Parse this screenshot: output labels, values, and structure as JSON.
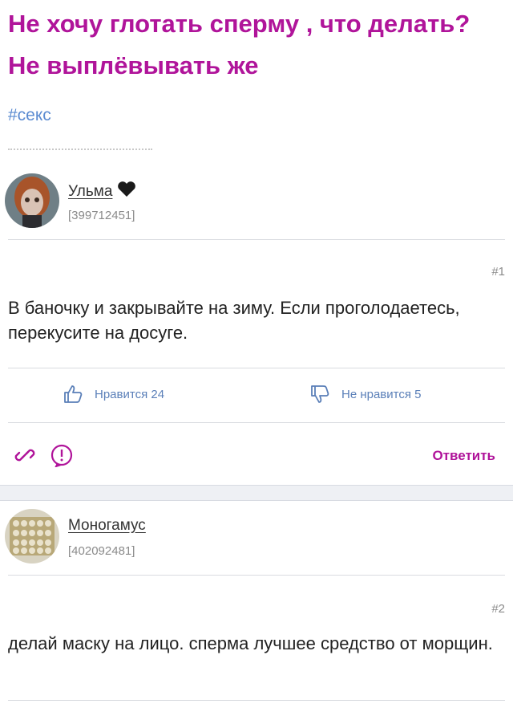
{
  "question": {
    "title": "Не хочу глотать сперму , что делать? Не выплёвывать же",
    "tag": "#секс"
  },
  "answers": [
    {
      "author": "Ульма",
      "author_id": "[399712451]",
      "number": "#1",
      "text": "В баночку и закрывайте на зиму. Если проголодаетесь, перекусите на досуге.",
      "like_label": "Нравится 24",
      "dislike_label": "Не нравится 5",
      "reply_label": "Ответить"
    },
    {
      "author": "Моногамус",
      "author_id": "[402092481]",
      "number": "#2",
      "text": "делай маску на лицо. сперма лучшее средство от морщин."
    }
  ],
  "colors": {
    "accent": "#b0149a",
    "link": "#5b8bd1",
    "vote": "#5a7fb8"
  },
  "icons": [
    "heart-icon",
    "like-icon",
    "dislike-icon",
    "link-icon",
    "report-icon"
  ]
}
